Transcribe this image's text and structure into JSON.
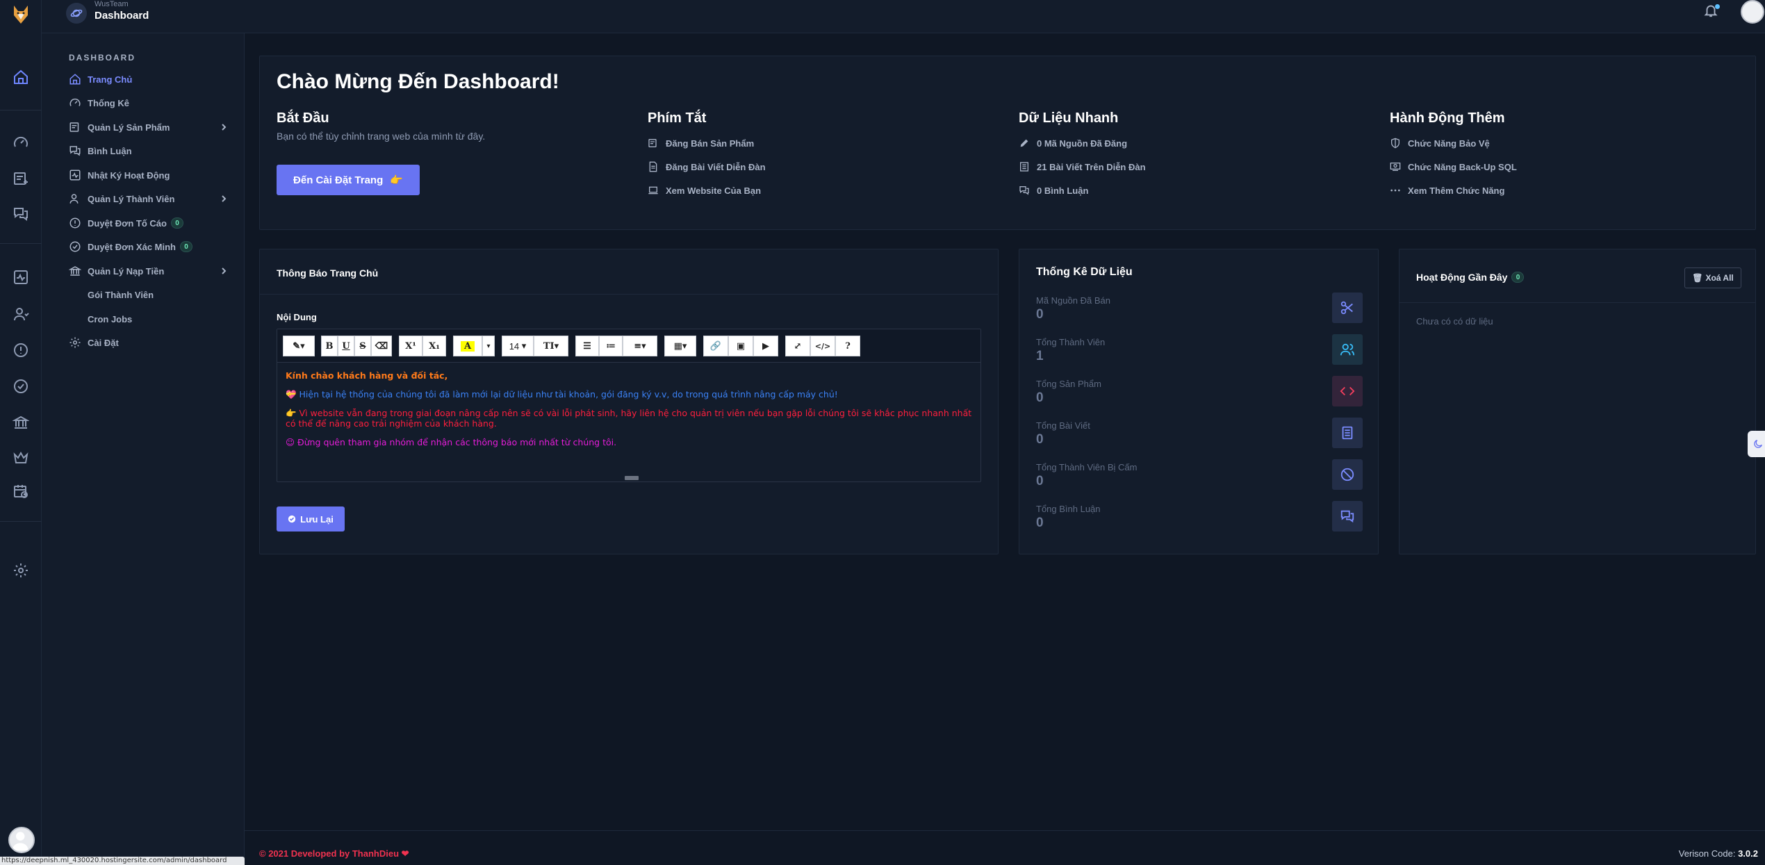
{
  "topbar": {
    "team": "WusTeam",
    "title": "Dashboard"
  },
  "sidebar": {
    "section": "DASHBOARD",
    "items": [
      {
        "label": "Trang Chủ",
        "icon": "home-icon",
        "active": true
      },
      {
        "label": "Thống Kê",
        "icon": "gauge-icon"
      },
      {
        "label": "Quản Lý Sản Phẩm",
        "icon": "product-icon",
        "expandable": true
      },
      {
        "label": "Bình Luận",
        "icon": "comments-icon"
      },
      {
        "label": "Nhật Ký Hoạt Động",
        "icon": "activity-icon"
      },
      {
        "label": "Quản Lý Thành Viên",
        "icon": "users-icon",
        "expandable": true
      },
      {
        "label": "Duyệt Đơn Tố Cáo",
        "icon": "alert-icon",
        "badge": "0"
      },
      {
        "label": "Duyệt Đơn Xác Minh",
        "icon": "check-circle-icon",
        "badge": "0"
      },
      {
        "label": "Quản Lý Nạp Tiền",
        "icon": "bank-icon",
        "expandable": true
      },
      {
        "label": "Gói Thành Viên",
        "icon": "crown-icon"
      },
      {
        "label": "Cron Jobs",
        "icon": "calendar-clock-icon"
      },
      {
        "label": "Cài Đặt",
        "icon": "gear-icon"
      }
    ]
  },
  "welcome": {
    "title": "Chào Mừng Đến Dashboard!",
    "start": {
      "heading": "Bắt Đầu",
      "sub": "Bạn có thể tùy chỉnh trang web của mình từ đây.",
      "button": "Đến Cài Đặt Trang"
    },
    "shortcuts": {
      "heading": "Phím Tắt",
      "links": [
        "Đăng Bán Sản Phẩm",
        "Đăng Bài Viết Diễn Đàn",
        "Xem Website Của Bạn"
      ]
    },
    "quick": {
      "heading": "Dữ Liệu Nhanh",
      "links": [
        "0 Mã Nguồn Đã Đăng",
        "21 Bài Viết Trên Diễn Đàn",
        "0 Bình Luận"
      ]
    },
    "more": {
      "heading": "Hành Động Thêm",
      "links": [
        "Chức Năng Bảo Vệ",
        "Chức Năng Back-Up SQL",
        "Xem Thêm Chức Năng"
      ]
    }
  },
  "notice": {
    "title": "Thông Báo Trang Chủ",
    "content_label": "Nội Dung",
    "font_size": "14",
    "lines": [
      "Kính chào khách hàng và đối tác,",
      "💝 Hiện tại hệ thống của chúng tôi đã làm mới lại dữ liệu như tài khoản, gói đăng ký v.v, do trong quá trình nâng cấp máy chủ!",
      "👉 Vì website vẫn đang trong giai đoạn nâng cấp nên sẽ có vài lỗi phát sinh, hãy liên hệ cho quản trị viên nếu bạn gặp lỗi chúng tôi sẽ khắc phục nhanh nhất có thể để nâng cao trải nghiệm của khách hàng.",
      "😉 Đừng quên tham gia nhóm để nhận các thông báo mới nhất từ chúng tôi."
    ],
    "save": "Lưu Lại"
  },
  "stats": {
    "title": "Thống Kê Dữ Liệu",
    "items": [
      {
        "label": "Mã Nguồn Đã Bán",
        "value": "0",
        "icon": "scissors-icon",
        "color": "#7b8cff"
      },
      {
        "label": "Tổng Thành Viên",
        "value": "1",
        "icon": "users-icon",
        "color": "#38bdf8"
      },
      {
        "label": "Tổng Sản Phẩm",
        "value": "0",
        "icon": "code-icon",
        "color": "#f43f5e"
      },
      {
        "label": "Tổng Bài Viết",
        "value": "0",
        "icon": "document-icon",
        "color": "#7b8cff"
      },
      {
        "label": "Tổng Thành Viên Bị Cấm",
        "value": "0",
        "icon": "ban-icon",
        "color": "#7b8cff"
      },
      {
        "label": "Tổng Bình Luận",
        "value": "0",
        "icon": "comments-icon",
        "color": "#7b8cff"
      }
    ]
  },
  "activity": {
    "title": "Hoạt Động Gần Đây",
    "badge": "0",
    "clear": "Xoá All",
    "empty": "Chưa có có dữ liệu"
  },
  "footer": {
    "left": "© 2021 Developed by ThanhDieu",
    "version_label": "Verison Code:",
    "version": "3.0.2"
  },
  "status_url": "https://deepnish.ml_430020.hostingersite.com/admin/dashboard"
}
